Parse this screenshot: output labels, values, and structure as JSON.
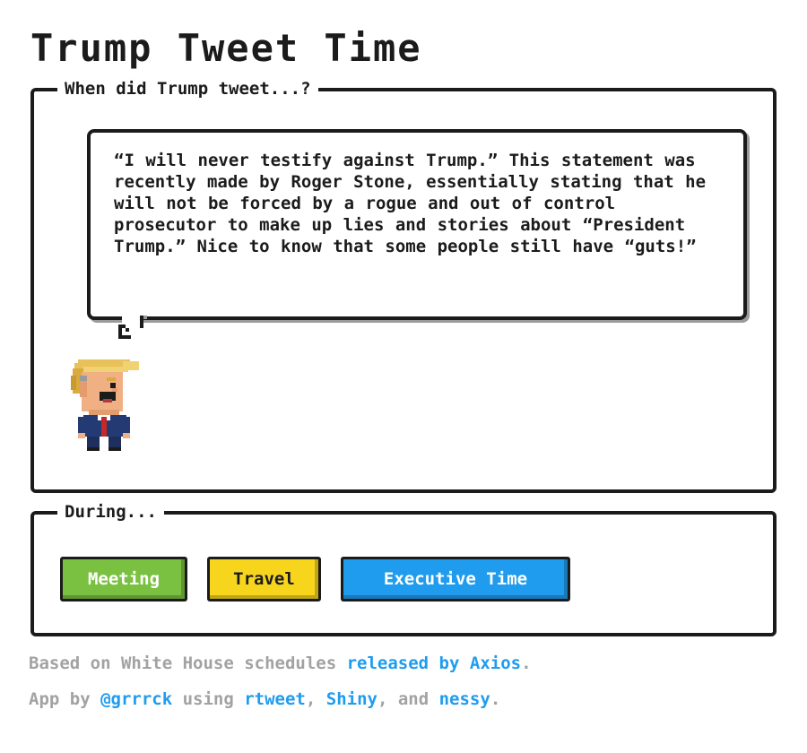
{
  "app": {
    "title": "Trump Tweet Time"
  },
  "tweet_panel": {
    "legend": "When did Trump tweet...?",
    "tweet_text": "“I will never testify against Trump.” This statement was recently made by Roger Stone, essentially stating that he will not be forced by a rogue and out of control prosecutor to make up lies and stories about “President Trump.” Nice to know that some people still have “guts!”",
    "avatar_icon": "trump-pixel-avatar"
  },
  "during_panel": {
    "legend": "During...",
    "buttons": [
      {
        "label": "Meeting",
        "color": "#7ac142"
      },
      {
        "label": "Travel",
        "color": "#f7d51d"
      },
      {
        "label": "Executive Time",
        "color": "#209cee"
      }
    ]
  },
  "footer": {
    "line1_prefix": "Based on White House schedules ",
    "line1_link": "released by Axios",
    "line1_suffix": ".",
    "line2_prefix": "App by ",
    "line2_link_author": "@grrrck",
    "line2_mid1": " using ",
    "line2_link_rtweet": "rtweet",
    "line2_sep1": ", ",
    "line2_link_shiny": "Shiny",
    "line2_sep2": ", and ",
    "line2_link_nessy": "nessy",
    "line2_suffix": "."
  },
  "colors": {
    "text": "#1b1b1b",
    "link": "#209cee",
    "muted": "#a2a2a2",
    "meeting": "#7ac142",
    "travel": "#f7d51d",
    "executive_time": "#209cee"
  }
}
